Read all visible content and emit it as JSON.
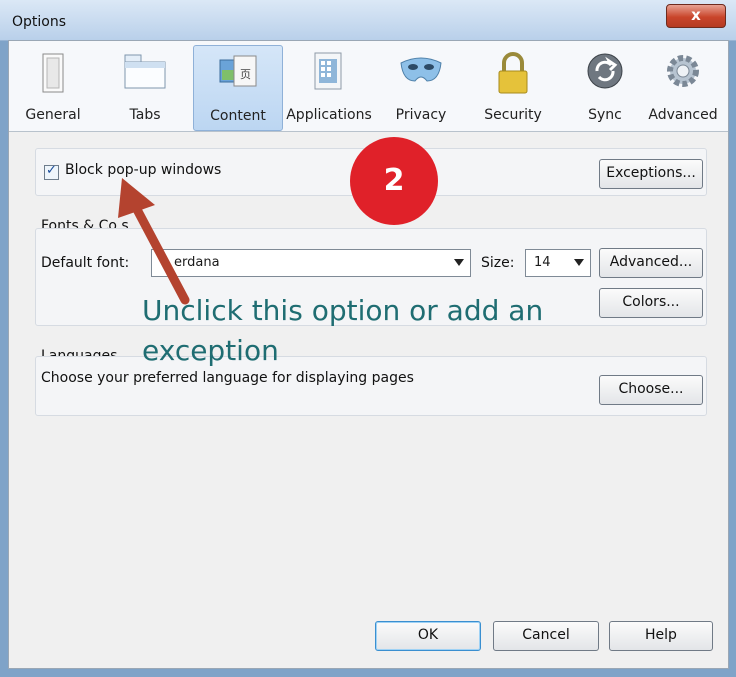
{
  "window": {
    "title": "Options",
    "close_glyph": "x"
  },
  "toolbar": {
    "items": [
      {
        "label": "General",
        "icon": "general-icon"
      },
      {
        "label": "Tabs",
        "icon": "tabs-icon"
      },
      {
        "label": "Content",
        "icon": "content-icon",
        "selected": true
      },
      {
        "label": "Applications",
        "icon": "applications-icon"
      },
      {
        "label": "Privacy",
        "icon": "privacy-mask-icon"
      },
      {
        "label": "Security",
        "icon": "padlock-icon"
      },
      {
        "label": "Sync",
        "icon": "sync-icon"
      },
      {
        "label": "Advanced",
        "icon": "gear-icon"
      }
    ]
  },
  "popups": {
    "checkbox_label": "Block pop-up windows",
    "checked": true,
    "exceptions_button": "Exceptions..."
  },
  "fonts": {
    "group_title": "Fonts & Co  s",
    "default_font_label": "Default font:",
    "default_font_value": "erdana",
    "size_label": "Size:",
    "size_value": "14",
    "advanced_button": "Advanced...",
    "colors_button": "Colors..."
  },
  "languages": {
    "group_title": "Languages",
    "description": "Choose your preferred language for displaying pages",
    "choose_button": "Choose..."
  },
  "footer": {
    "ok": "OK",
    "cancel": "Cancel",
    "help": "Help"
  },
  "annotation": {
    "badge": "2",
    "line1": "Unclick this option or add an",
    "line2": "exception",
    "arrow_color": "#b4432f",
    "text_color": "#1f6d72"
  }
}
